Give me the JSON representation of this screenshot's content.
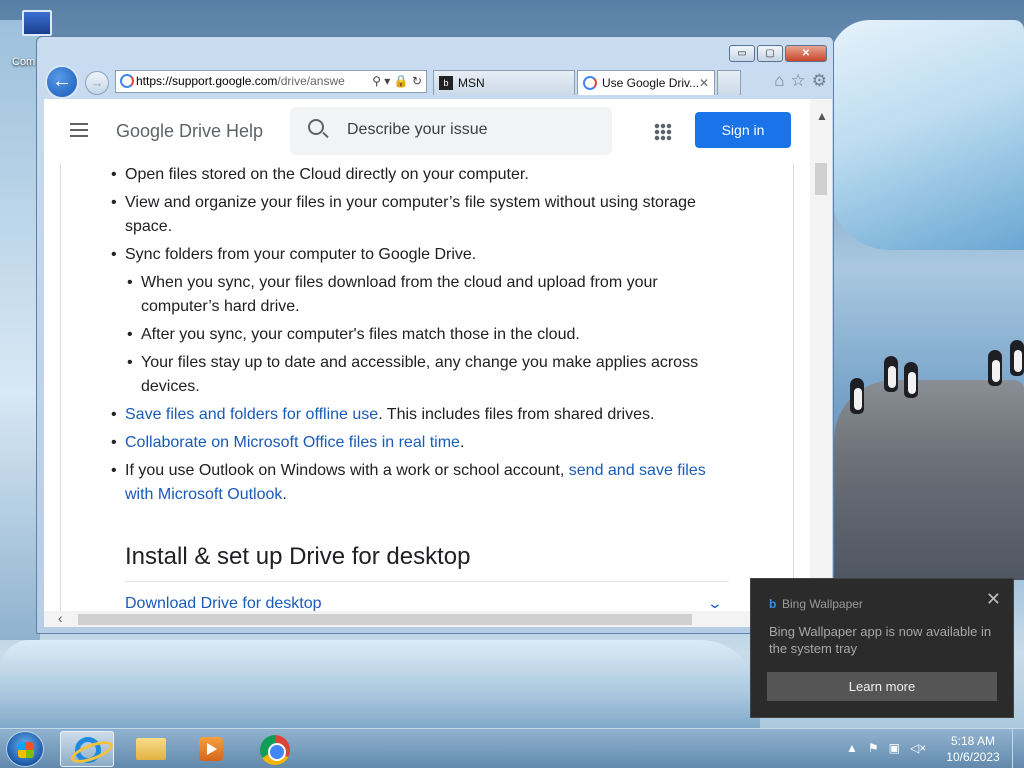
{
  "desktop": {
    "icon_label": "Com"
  },
  "browser": {
    "address": {
      "host": "https://support.google.com",
      "rest": "/drive/answe"
    },
    "tabs": [
      {
        "label": "MSN",
        "active": false
      },
      {
        "label": "Use Google Driv...",
        "active": true,
        "close": "✕"
      }
    ],
    "window_buttons": {
      "minimize": "▭",
      "maximize": "▢",
      "close": "✕"
    }
  },
  "page": {
    "brand": "Google Drive Help",
    "search_placeholder": "Describe your issue",
    "signin": "Sign in",
    "items": [
      {
        "text": "Open files stored on the Cloud directly on your computer."
      },
      {
        "line1": "View and organize your files in your computer’s file system without using storage",
        "line2": "space."
      },
      {
        "text": "Sync folders from your computer to Google Drive."
      },
      {
        "line1": "When you sync, your files download from the cloud and upload from your",
        "line2": "computer’s hard drive."
      },
      {
        "text": "After you sync, your computer's files match those in the cloud."
      },
      {
        "line1": "Your files stay up to date and accessible, any change you make applies across",
        "line2": "devices."
      },
      {
        "link": "Save files and folders for offline use",
        "after": ". This includes files from shared drives."
      },
      {
        "link": "Collaborate on Microsoft Office files in real time",
        "after": "."
      },
      {
        "before": "If you use Outlook on Windows with a work or school account, ",
        "link1": "send and save files",
        "link2": "with Microsoft Outlook",
        "after": "."
      }
    ],
    "heading": "Install & set up Drive for desktop",
    "expand_link": "Download Drive for desktop"
  },
  "toast": {
    "app": "Bing Wallpaper",
    "message": "Bing Wallpaper app is now available in the system tray",
    "button": "Learn more"
  },
  "taskbar": {
    "time": "5:18 AM",
    "date": "10/6/2023"
  }
}
